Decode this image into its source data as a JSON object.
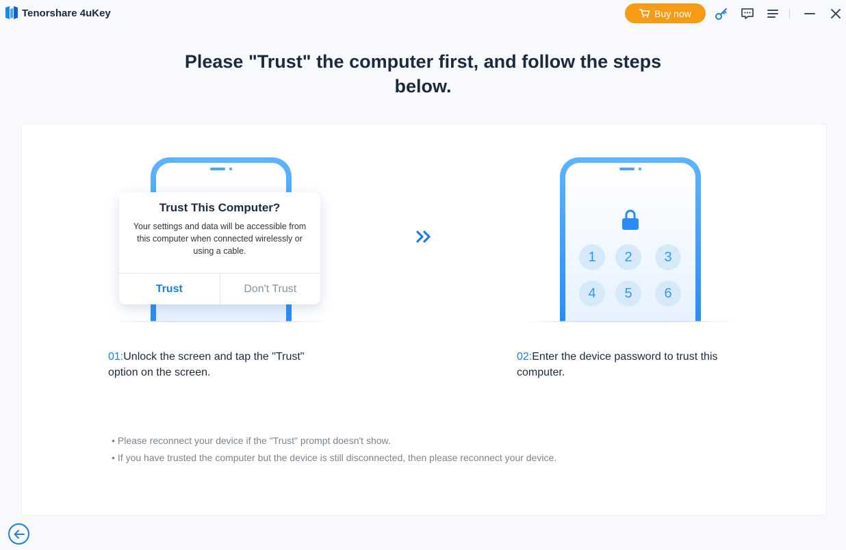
{
  "app": {
    "name": "Tenorshare 4uKey"
  },
  "toolbar": {
    "buy_label": "Buy now",
    "icons": [
      "cart-icon",
      "key-icon",
      "feedback-icon",
      "menu-icon",
      "minimize-icon",
      "close-icon"
    ]
  },
  "headline": {
    "line1": "Please \"Trust\" the computer first, and follow the steps",
    "line2": "below."
  },
  "dialog": {
    "title": "Trust This Computer?",
    "body": "Your settings and data will be accessible from this computer when connected wirelessly or using a cable.",
    "trust_label": "Trust",
    "dont_trust_label": "Don't Trust"
  },
  "keypad": {
    "keys": [
      "1",
      "2",
      "3",
      "4",
      "5",
      "6"
    ]
  },
  "steps": [
    {
      "num": "01:",
      "text_line1": "Unlock the screen and tap the \"Trust\"",
      "text_line2": "option on the screen."
    },
    {
      "num": "02:",
      "text_line1": "Enter the device password to trust this",
      "text_line2": "computer."
    }
  ],
  "notes": [
    "Please reconnect your device if the \"Trust\" prompt doesn't show.",
    "If you have trusted the computer but the device is still disconnected, then please reconnect your device."
  ],
  "colors": {
    "accent": "#1d7fe0",
    "buy": "#f59b16",
    "phone": "#2a8cf6"
  }
}
